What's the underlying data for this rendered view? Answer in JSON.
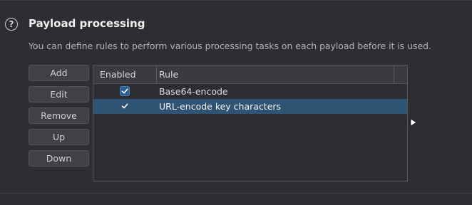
{
  "section": {
    "title": "Payload processing",
    "description": "You can define rules to perform various processing tasks on each payload before it is used."
  },
  "buttons": {
    "add": "Add",
    "edit": "Edit",
    "remove": "Remove",
    "up": "Up",
    "down": "Down"
  },
  "table": {
    "columns": [
      "Enabled",
      "Rule"
    ],
    "rows": [
      {
        "enabled": true,
        "rule": "Base64-encode",
        "selected": false
      },
      {
        "enabled": true,
        "rule": "URL-encode key characters",
        "selected": true
      }
    ]
  },
  "colors": {
    "background": "#2c2e31",
    "selection": "#2f5473",
    "checkbox": "#2d5e8e"
  },
  "icons": {
    "help": "help-circle-icon",
    "check": "check-icon",
    "pointer": "mouse-pointer-icon"
  }
}
